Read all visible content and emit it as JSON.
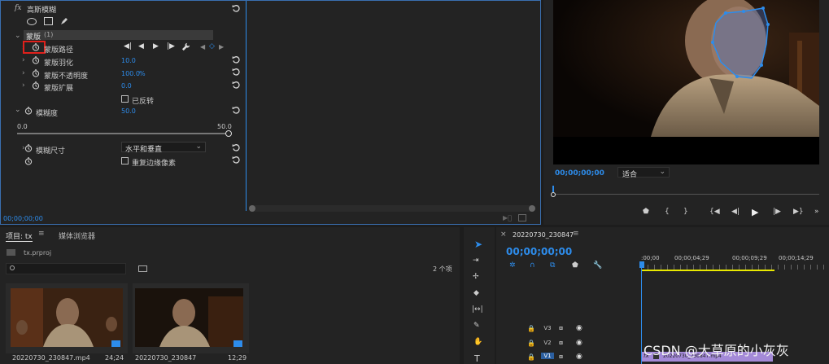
{
  "effect_controls": {
    "effect_name": "高斯模糊",
    "mask_name": "蒙版",
    "mask_count": "(1)",
    "mask_path_label": "蒙版路径",
    "feather_label": "蒙版羽化",
    "feather_value": "10.0",
    "opacity_label": "蒙版不透明度",
    "opacity_value": "100.0",
    "opacity_unit": "%",
    "expansion_label": "蒙版扩展",
    "expansion_value": "0.0",
    "inverted_label": "已反转",
    "blurriness_label": "模糊度",
    "blurriness_value": "50.0",
    "slider_min": "0.0",
    "slider_max": "50.0",
    "blur_dimensions_label": "模糊尺寸",
    "blur_dimensions_value": "水平和垂直",
    "repeat_edge_label": "重复边缘像素",
    "timecode": "00;00;00;00"
  },
  "program_monitor": {
    "timecode": "00;00;00;00",
    "fit_value": "适合"
  },
  "project_panel": {
    "tab_project": "项目: tx",
    "tab_media_browser": "媒体浏览器",
    "project_file": "tx.prproj",
    "item_count": "2 个项",
    "items": [
      {
        "name": "20220730_230847.mp4",
        "duration": "24;24"
      },
      {
        "name": "20220730_230847",
        "duration": "12;29"
      }
    ]
  },
  "timeline": {
    "sequence_name": "20220730_230847",
    "timecode": "00;00;00;00",
    "ruler_labels": [
      ":00;00",
      "00;00;04;29",
      "00;00;09;29",
      "00;00;14;29"
    ],
    "tracks": [
      {
        "name": "V3"
      },
      {
        "name": "V2"
      },
      {
        "name": "V1"
      }
    ],
    "clip_fx": "fx",
    "clip_name": "20220730_230847.mp4"
  },
  "watermark": "CSDN @大草原的小灰灰",
  "colors": {
    "accent_blue": "#2d8ceb",
    "highlight_red": "#e0201b",
    "clip_purple": "#a48ad8",
    "work_area_yellow": "#e8e800"
  }
}
